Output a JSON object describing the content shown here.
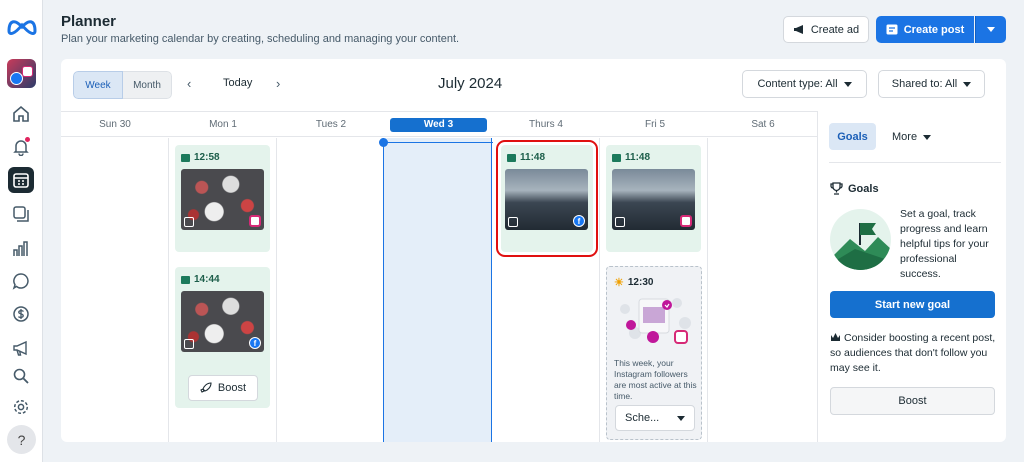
{
  "header": {
    "title": "Planner",
    "subtitle": "Plan your marketing calendar by creating, scheduling and managing your content.",
    "create_ad_label": "Create ad",
    "create_post_label": "Create post"
  },
  "toolbar": {
    "view_week": "Week",
    "view_month": "Month",
    "today_label": "Today",
    "month_title": "July 2024",
    "content_type_label": "Content type: All",
    "shared_to_label": "Shared to: All"
  },
  "days": [
    "Sun 30",
    "Mon 1",
    "Tues 2",
    "Wed 3",
    "Thurs 4",
    "Fri 5",
    "Sat 6"
  ],
  "posts": {
    "mon_1": {
      "time": "12:58",
      "platform": "instagram"
    },
    "mon_2": {
      "time": "14:44",
      "platform": "facebook",
      "boost_label": "Boost"
    },
    "thu_1": {
      "time": "11:48",
      "platform": "facebook"
    },
    "fri_1": {
      "time": "11:48",
      "platform": "instagram"
    }
  },
  "suggestion": {
    "time": "12:30",
    "text": "This week, your Instagram followers are most active at this time.",
    "schedule_label": "Sche..."
  },
  "side": {
    "tab_goals": "Goals",
    "tab_more": "More",
    "goals_heading": "Goals",
    "goals_text": "Set a goal, track progress and learn helpful tips for your professional success.",
    "start_goal_label": "Start new goal",
    "boost_tip": "Consider boosting a recent post, so audiences that don't follow you may see it.",
    "boost_label": "Boost"
  },
  "colors": {
    "accent": "#1b74e4",
    "card_bg": "#e4f3ec",
    "selection_outline": "#e01010"
  }
}
